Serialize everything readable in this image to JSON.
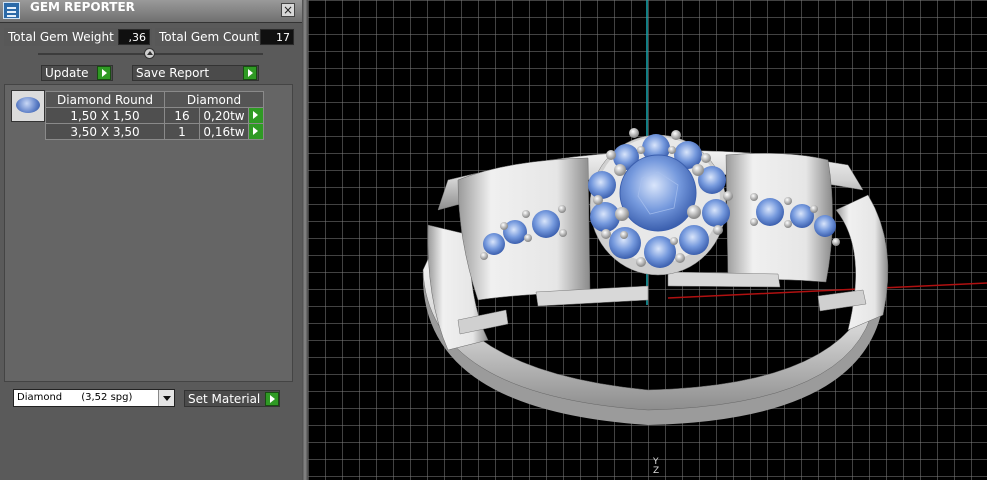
{
  "window": {
    "title": "GEM REPORTER",
    "close_label": "×"
  },
  "stats": {
    "total_weight_label": "Total Gem Weight",
    "total_weight_value": ",36",
    "total_count_label": "Total Gem Count",
    "total_count_value": "17"
  },
  "buttons": {
    "update_label": "Update",
    "save_report_label": "Save Report",
    "set_material_label": "Set Material"
  },
  "report": {
    "headers": [
      "Diamond Round",
      "Diamond"
    ],
    "rows": [
      {
        "size": "1,50 X 1,50",
        "count": "16",
        "weight": "0,20tw"
      },
      {
        "size": "3,50 X 3,50",
        "count": "1",
        "weight": "0,16tw"
      }
    ]
  },
  "material": {
    "selected": "Diamond      (3,52 spg)"
  },
  "viewport": {
    "axis_label_y": "Y",
    "axis_label_z": "Z"
  },
  "colors": {
    "gem_blue": "#6f95dc",
    "metal": "#e2e2e2",
    "grid": "#787878",
    "axis_y": "#18a8b0",
    "axis_x": "#b01010",
    "play_green": "#2f9a24"
  },
  "icons": [
    "app-icon",
    "close-icon",
    "slider-knob-icon",
    "play-arrow-icon",
    "gem-thumbnail-icon",
    "chevron-down-icon"
  ]
}
